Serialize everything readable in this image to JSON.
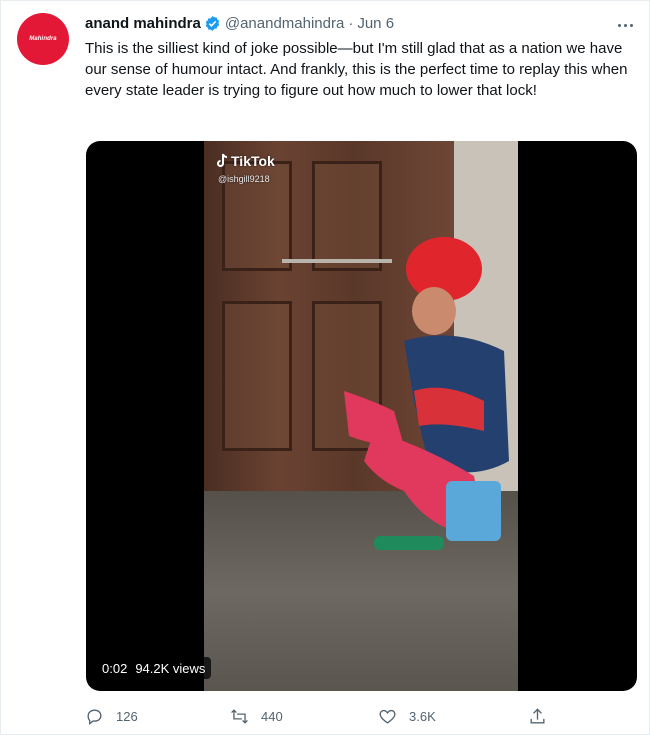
{
  "tweet": {
    "avatar_logo_text": "Mahindra",
    "author_name": "anand mahindra",
    "handle": "@anandmahindra",
    "separator": "·",
    "date": "Jun 6",
    "text": "This is the silliest kind of joke possible—but I'm still glad that as a nation we have our sense of humour intact. And frankly, this is the perfect time to replay this when every state leader is trying to figure out how much to lower that lock!"
  },
  "media": {
    "watermark": "TikTok",
    "watermark_user": "@ishgill9218",
    "elapsed": "0:02",
    "views": "94.2K views"
  },
  "actions": {
    "reply_count": "126",
    "retweet_count": "440",
    "like_count": "3.6K"
  },
  "icons": {
    "verified": "verified-badge-icon",
    "more": "more-dots-icon",
    "reply": "reply-icon",
    "retweet": "retweet-icon",
    "like": "heart-icon",
    "share": "share-icon"
  },
  "colors": {
    "brand_red": "#e31837",
    "verified_blue": "#1d9bf0",
    "muted_text": "#536471"
  }
}
